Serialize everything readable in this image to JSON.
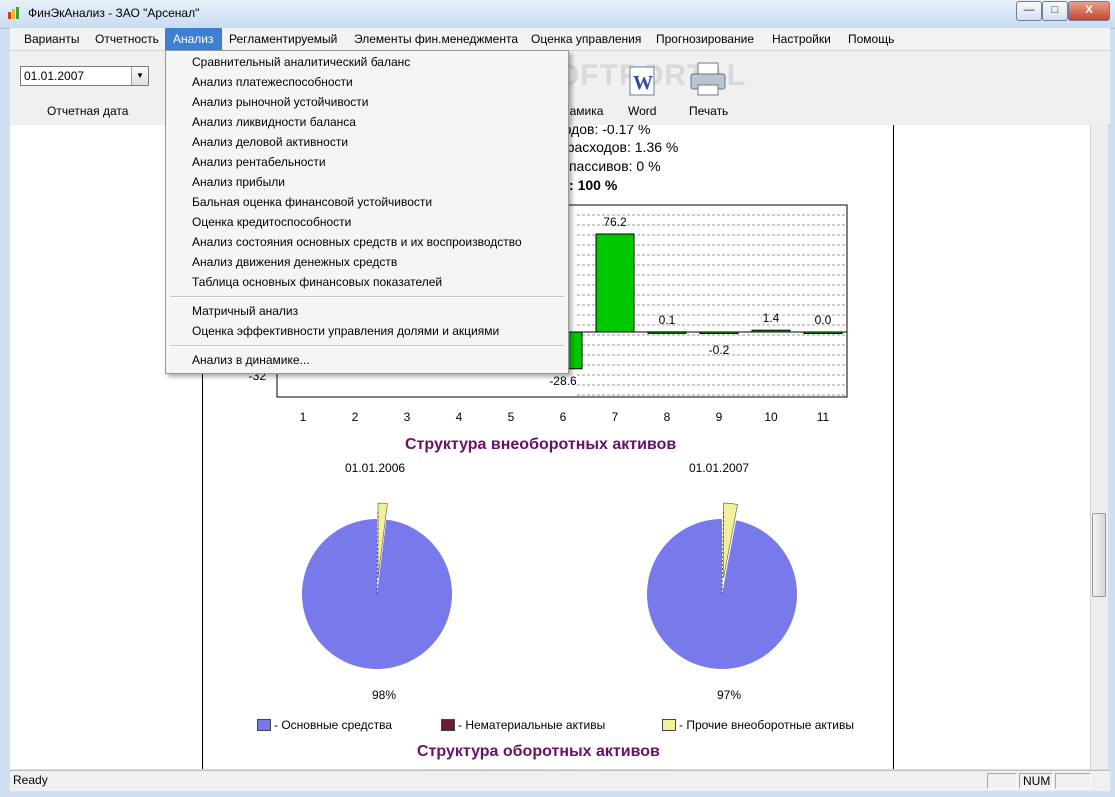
{
  "window": {
    "title": "ФинЭкАнализ - ЗАО \"Арсенал\"",
    "controls": [
      "—",
      "□",
      "X"
    ]
  },
  "menu": {
    "items": [
      "Варианты",
      "Отчетность",
      "Анализ",
      "Регламентируемый",
      "Элементы фин.менеджмента",
      "Оценка управления",
      "Прогнозирование",
      "Настройки",
      "Помощь"
    ],
    "active": "Анализ"
  },
  "toolbar": {
    "date_value": "01.01.2007",
    "date_label": "Отчетная дата",
    "buttons": [
      "намика",
      "Word",
      "Печать"
    ]
  },
  "dropdown": {
    "items": [
      "Сравнительный аналитический баланс",
      "Анализ платежеспособности",
      "Анализ рыночной устойчивости",
      "Анализ ликвидности баланса",
      "Анализ деловой активности",
      "Анализ рентабельности",
      "Анализ прибыли",
      "Бальная оценка финансовой устойчивости",
      "Оценка кредитоспособности",
      "Анализ состояния основных средств и их воспроизводство",
      "Анализ движения денежных средств",
      "Таблица основных финансовых показателей",
      "Матричный анализ",
      "Оценка эффективности управления долями и акциями",
      "Анализ в динамике..."
    ]
  },
  "report": {
    "lines": [
      "риодов: -0.17 %",
      "их расходов: 1.36 %",
      "ых пассивов: 0 %",
      "ов : 100 %"
    ],
    "axis_min_label": "-32",
    "pie_section_title": "Структура внеоборотных активов",
    "pie_dates": [
      "01.01.2006",
      "01.01.2007"
    ],
    "pie_percents": [
      "98%",
      "97%"
    ],
    "legend": [
      "- Основные средства",
      "- Нематериальные активы",
      "- Прочие внеоборотные активы"
    ],
    "next_section_title": "Структура оборотных активов"
  },
  "chart_data": [
    {
      "type": "bar",
      "categories": [
        "1",
        "2",
        "3",
        "4",
        "5",
        "6",
        "7",
        "8",
        "9",
        "10",
        "11"
      ],
      "visible_value_labels": {
        "6": -28.6,
        "7": 76.2,
        "8": 0.1,
        "9": -0.2,
        "10": 1.4,
        "11": 0.0
      },
      "series": [
        {
          "values": [
            null,
            null,
            null,
            null,
            null,
            -28.6,
            76.2,
            0.1,
            -0.2,
            1.4,
            0.0
          ]
        }
      ],
      "y_axis_min_label": "-32",
      "grid": true
    },
    {
      "type": "pie",
      "title": "01.01.2006",
      "labels": [
        "Основные средства",
        "Нематериальные активы",
        "Прочие внеоборотные активы"
      ],
      "values": [
        98,
        0,
        2
      ],
      "colors": [
        "#7879ea",
        "#6b1a3a",
        "#f2f09a"
      ]
    },
    {
      "type": "pie",
      "title": "01.01.2007",
      "labels": [
        "Основные средства",
        "Нематериальные активы",
        "Прочие внеоборотные активы"
      ],
      "values": [
        97,
        0,
        3
      ],
      "colors": [
        "#7879ea",
        "#6b1a3a",
        "#f2f09a"
      ]
    }
  ],
  "status": {
    "text": "Ready",
    "num": "NUM"
  },
  "watermark": "SOFTPORTAL www.softportal.com"
}
